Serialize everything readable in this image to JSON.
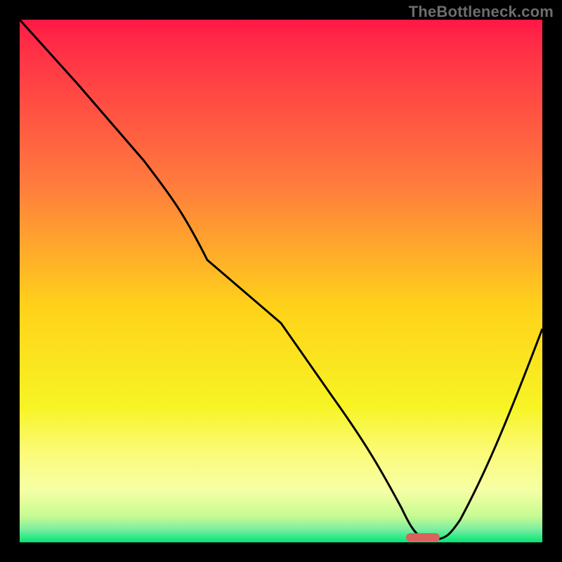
{
  "watermark": "TheBottleneck.com",
  "chart_data": {
    "type": "line",
    "title": "",
    "xlabel": "",
    "ylabel": "",
    "xlim": [
      0,
      100
    ],
    "ylim": [
      0,
      100
    ],
    "grid": false,
    "legend": false,
    "background": {
      "type": "vertical-gradient",
      "stops": [
        {
          "pos": 0.0,
          "color": "#ff1744"
        },
        {
          "pos": 0.04,
          "color": "#ff2a47"
        },
        {
          "pos": 0.32,
          "color": "#ff7d3d"
        },
        {
          "pos": 0.55,
          "color": "#ffd21a"
        },
        {
          "pos": 0.74,
          "color": "#f7f424"
        },
        {
          "pos": 0.83,
          "color": "#fbfb7a"
        },
        {
          "pos": 0.9,
          "color": "#f6ffa5"
        },
        {
          "pos": 0.95,
          "color": "#c6fb92"
        },
        {
          "pos": 0.975,
          "color": "#7ceea0"
        },
        {
          "pos": 1.0,
          "color": "#00e676"
        }
      ]
    },
    "series": [
      {
        "name": "bottleneck-curve",
        "color": "#000000",
        "x": [
          0,
          11,
          24,
          32,
          40,
          50,
          60,
          66,
          70,
          73,
          75,
          78,
          80,
          84,
          90,
          100
        ],
        "y": [
          100,
          88,
          73,
          65,
          54,
          41,
          27,
          18,
          11,
          6,
          3,
          1,
          1,
          5,
          18,
          40
        ]
      }
    ],
    "marker": {
      "name": "optimal-zone",
      "color": "#d7625e",
      "x_center": 77,
      "y": 0.5,
      "width": 6,
      "height": 1.5,
      "shape": "rounded-bar"
    }
  }
}
